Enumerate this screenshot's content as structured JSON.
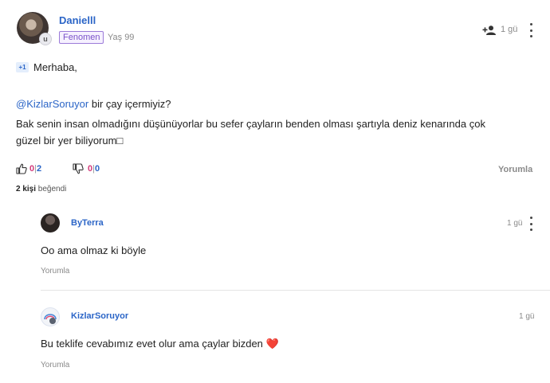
{
  "post": {
    "author": {
      "name": "Danielll",
      "badge": "Fenomen",
      "age": "Yaş 99",
      "avatar_badge": "u"
    },
    "time": "1 gü",
    "plus_badge": "+1",
    "greeting": "Merhaba,",
    "mention": "@KizlarSoruyor",
    "mention_rest": " bir çay içermiyiz?",
    "body_line1": "Bak senin insan olmadığını düşünüyorlar bu sefer çayların benden olması şartıyla deniz kenarında çok",
    "body_line2": "güzel bir yer biliyorum□",
    "likes": {
      "count": "0",
      "sep": "|",
      "total": "2"
    },
    "dislikes": {
      "count": "0",
      "sep": "|",
      "total": "0"
    },
    "reply_label": "Yorumla",
    "liked_by_count": "2 kişi",
    "liked_by_text": " beğendi"
  },
  "replies": [
    {
      "author": "ByTerra",
      "time": "1 gü",
      "text": "Oo ama olmaz ki böyle",
      "reply_label": "Yorumla"
    },
    {
      "author": "KizlarSoruyor",
      "time": "1 gü",
      "text": "Bu teklife cevabımız evet olur ama çaylar bizden",
      "emoji": "❤️",
      "reply_label": "Yorumla"
    }
  ],
  "colors": {
    "link": "#2b65c7",
    "like": "#d33a7a",
    "badge_purple": "#7a52c9"
  },
  "icons": [
    "follow-user-icon",
    "more-options-icon",
    "like-icon",
    "dislike-icon",
    "heart-icon"
  ]
}
